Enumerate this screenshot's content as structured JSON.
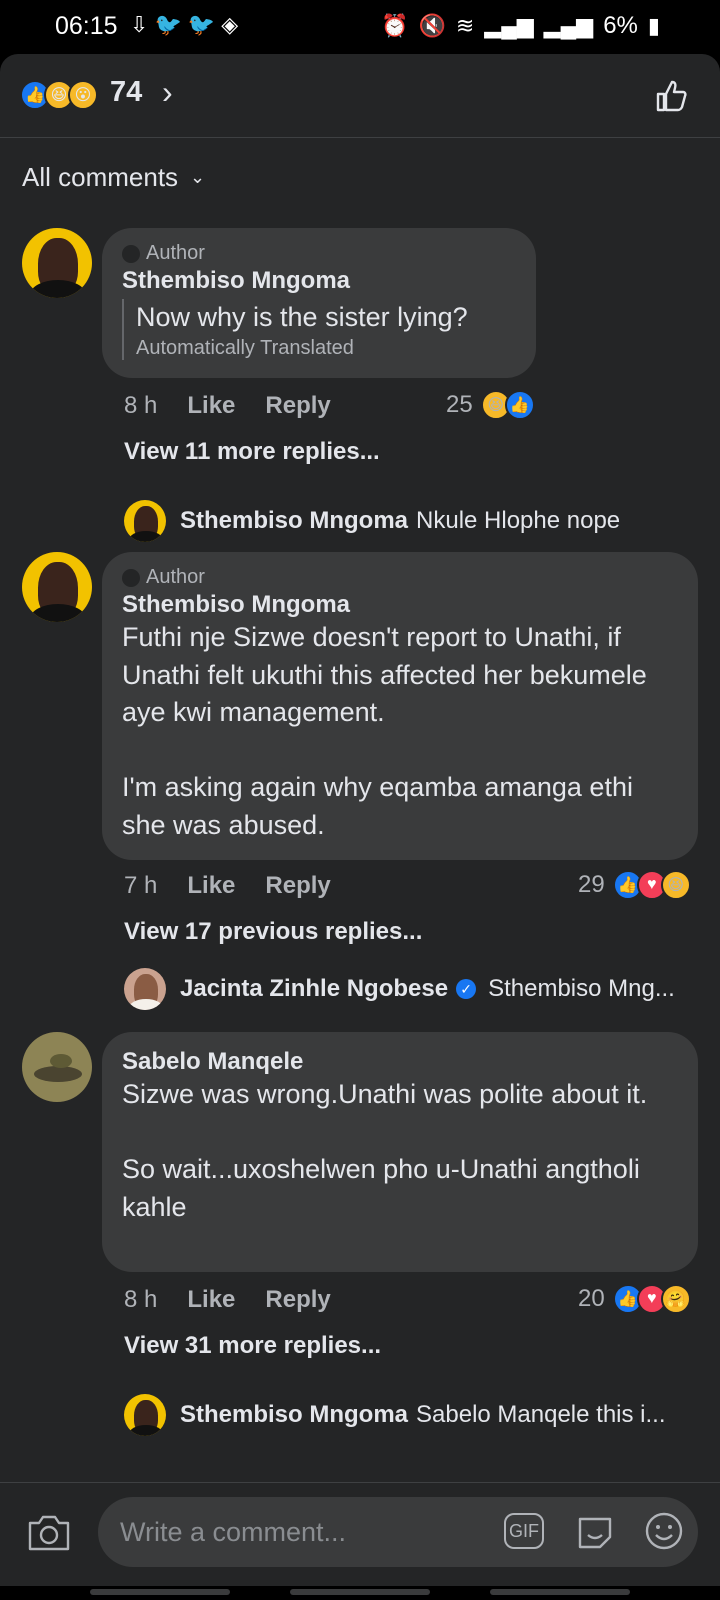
{
  "status_bar": {
    "time": "06:15",
    "battery": "6%",
    "left_icons": [
      "download-icon",
      "twitter-icon",
      "twitter-icon",
      "code-icon"
    ],
    "right_icons": [
      "alarm-icon",
      "mute-icon",
      "wifi-icon",
      "signal-icon",
      "signal-icon"
    ]
  },
  "reactions_header": {
    "icons": [
      "like",
      "haha",
      "wow"
    ],
    "count": "74"
  },
  "filter": {
    "label": "All comments"
  },
  "comments": [
    {
      "author_tag": "Author",
      "name": "Sthembiso Mngoma",
      "text": "Now why is the sister lying?",
      "translation_note": "Automatically Translated",
      "time": "8 h",
      "like_label": "Like",
      "reply_label": "Reply",
      "reaction_count": "25",
      "reactions": [
        "haha",
        "like"
      ],
      "more_replies": "View 11 more replies...",
      "preview_reply": {
        "name": "Sthembiso Mngoma",
        "text": "Nkule Hlophe nope"
      }
    },
    {
      "author_tag": "Author",
      "name": "Sthembiso Mngoma",
      "text": "Futhi nje Sizwe doesn't report to Unathi, if Unathi felt ukuthi this affected her bekumele aye kwi management.\n\nI'm asking again why eqamba amanga ethi she was abused.",
      "time": "7 h",
      "like_label": "Like",
      "reply_label": "Reply",
      "reaction_count": "29",
      "reactions": [
        "like",
        "love",
        "haha"
      ],
      "more_replies": "View 17 previous replies...",
      "preview_reply": {
        "name": "Jacinta Zinhle Ngobese",
        "text": "Sthembiso Mng...",
        "verified": true
      }
    },
    {
      "name": "Sabelo Manqele",
      "text": "Sizwe was wrong.Unathi was polite about it.\n\nSo wait...uxoshelwen pho u-Unathi angtholi kahle",
      "time": "8 h",
      "like_label": "Like",
      "reply_label": "Reply",
      "reaction_count": "20",
      "reactions": [
        "like",
        "love",
        "care"
      ],
      "more_replies": "View 31 more replies...",
      "preview_reply": {
        "name": "Sthembiso Mngoma",
        "text": "Sabelo Manqele this i..."
      }
    }
  ],
  "composer": {
    "placeholder": "Write a comment...",
    "gif_label": "GIF"
  }
}
